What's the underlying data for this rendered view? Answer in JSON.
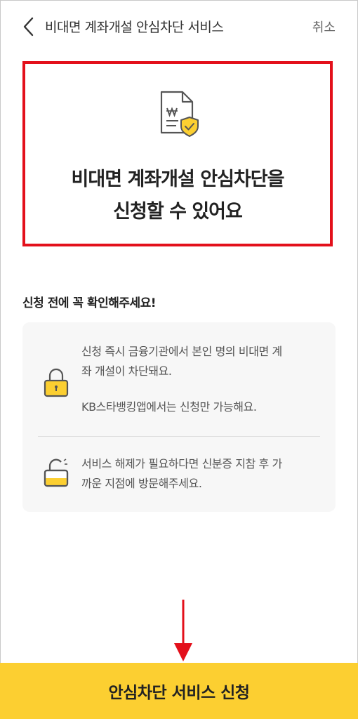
{
  "header": {
    "title": "비대면 계좌개설 안심차단 서비스",
    "cancel_label": "취소"
  },
  "hero": {
    "icon": "document-won-shield-icon",
    "title_line1": "비대면 계좌개설 안심차단을",
    "title_line2": "신청할 수 있어요"
  },
  "notice": {
    "heading": "신청 전에 꼭 확인해주세요!",
    "items": [
      {
        "icon": "lock-closed-icon",
        "text_line1": "신청 즉시 금융기관에서 본인 명의 비대면 계",
        "text_line2": "좌 개설이 차단돼요.",
        "text_line3": "KB스타뱅킹앱에서는 신청만 가능해요."
      },
      {
        "icon": "lock-open-icon",
        "text_line1": "서비스 해제가 필요하다면 신분증 지참 후 가",
        "text_line2": "까운 지점에 방문해주세요."
      }
    ]
  },
  "footer": {
    "apply_label": "안심차단 서비스 신청"
  },
  "colors": {
    "accent_yellow": "#fccf31",
    "highlight_red": "#e3101b",
    "card_bg": "#f7f7f7"
  }
}
